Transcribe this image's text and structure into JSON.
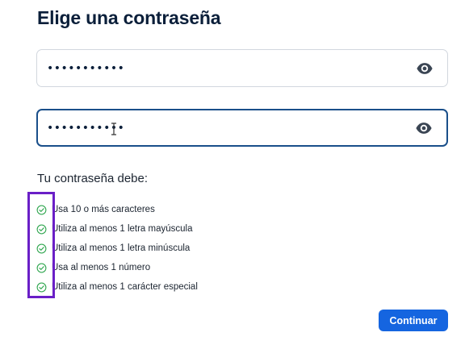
{
  "page": {
    "title": "Elige una contraseña"
  },
  "fields": {
    "password": {
      "value": "•••••••••••",
      "toggle_icon": "eye-icon"
    },
    "confirm_password": {
      "value": "•••••••••••",
      "toggle_icon": "eye-icon"
    }
  },
  "requirements": {
    "title": "Tu contraseña debe:",
    "items": [
      {
        "label": "Usa 10 o más caracteres",
        "icon": "check-circle-icon",
        "status": "met"
      },
      {
        "label": "Utiliza al menos 1 letra mayúscula",
        "icon": "check-circle-icon",
        "status": "met"
      },
      {
        "label": "Utiliza al menos 1 letra minúscula",
        "icon": "check-circle-icon",
        "status": "met"
      },
      {
        "label": "Usa al menos 1 número",
        "icon": "check-circle-icon",
        "status": "met"
      },
      {
        "label": "Utiliza al menos 1 carácter especial",
        "icon": "check-circle-icon",
        "status": "met"
      }
    ]
  },
  "actions": {
    "continue_label": "Continuar"
  },
  "colors": {
    "primary_button": "#1565e0",
    "check_green": "#34a853",
    "focus_border": "#1a4f8a",
    "highlight_annotation": "#6a1fc7"
  }
}
